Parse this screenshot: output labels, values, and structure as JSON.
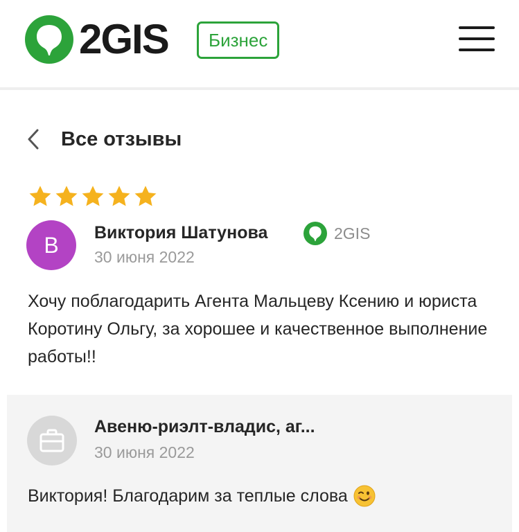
{
  "header": {
    "logo_text": "2GIS",
    "badge_label": "Бизнес",
    "brand_color": "#2ca33a",
    "menu_icon": "hamburger-menu-icon"
  },
  "navigation": {
    "back_label": "Все отзывы",
    "back_icon": "chevron-left-icon"
  },
  "review": {
    "rating": 5,
    "rating_max": 5,
    "star_color": "#f5b21e",
    "author_initial": "В",
    "avatar_color": "#b343c4",
    "author_name": "Виктория Шатунова",
    "source_label": "2GIS",
    "date": "30 июня 2022",
    "text": "Хочу поблагодарить Агента Мальцеву Ксению и юриста Коротину Ольгу, за хорошее и качественное выполнение работы!!"
  },
  "reply": {
    "author_name": "Авеню-риэлт-владис, аг...",
    "avatar_icon": "briefcase-icon",
    "date": "30 июня 2022",
    "text": "Виктория! Благодарим за теплые слова",
    "emoji": "winking-face-emoji"
  }
}
